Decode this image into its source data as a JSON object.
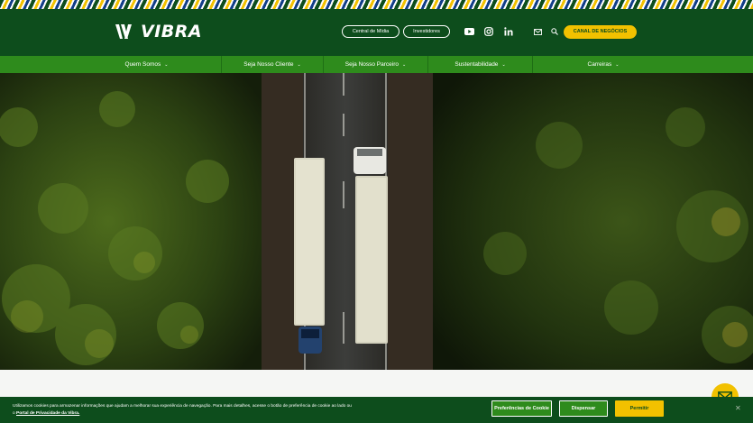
{
  "brand": {
    "name": "VIBRA"
  },
  "header": {
    "links": [
      {
        "label": "Central de Mídia"
      },
      {
        "label": "Investidores"
      }
    ],
    "social": [
      "youtube-icon",
      "instagram-icon",
      "linkedin-icon"
    ],
    "cta_label": "CANAL DE NEGÓCIOS"
  },
  "nav": {
    "items": [
      {
        "label": "Quem Somos"
      },
      {
        "label": "Seja Nosso Cliente"
      },
      {
        "label": "Seja Nosso Parceiro"
      },
      {
        "label": "Sustentabilidade"
      },
      {
        "label": "Carreiras"
      }
    ]
  },
  "cookie": {
    "text": "Utilizamos cookies para armazenar informações que ajudam a melhorar sua experiência de navegação. Para mais detalhes, acesse o botão de preferência de cookie ao lado ou",
    "text_prefix": "o",
    "link_label": "Portal de Privacidade da Vibra.",
    "preferences_label": "Preferências de Cookie",
    "dismiss_label": "Dispensar",
    "allow_label": "Permitir"
  },
  "colors": {
    "header_bg": "#0d4d1c",
    "nav_bg": "#2e8b1c",
    "accent_yellow": "#f2c100"
  }
}
